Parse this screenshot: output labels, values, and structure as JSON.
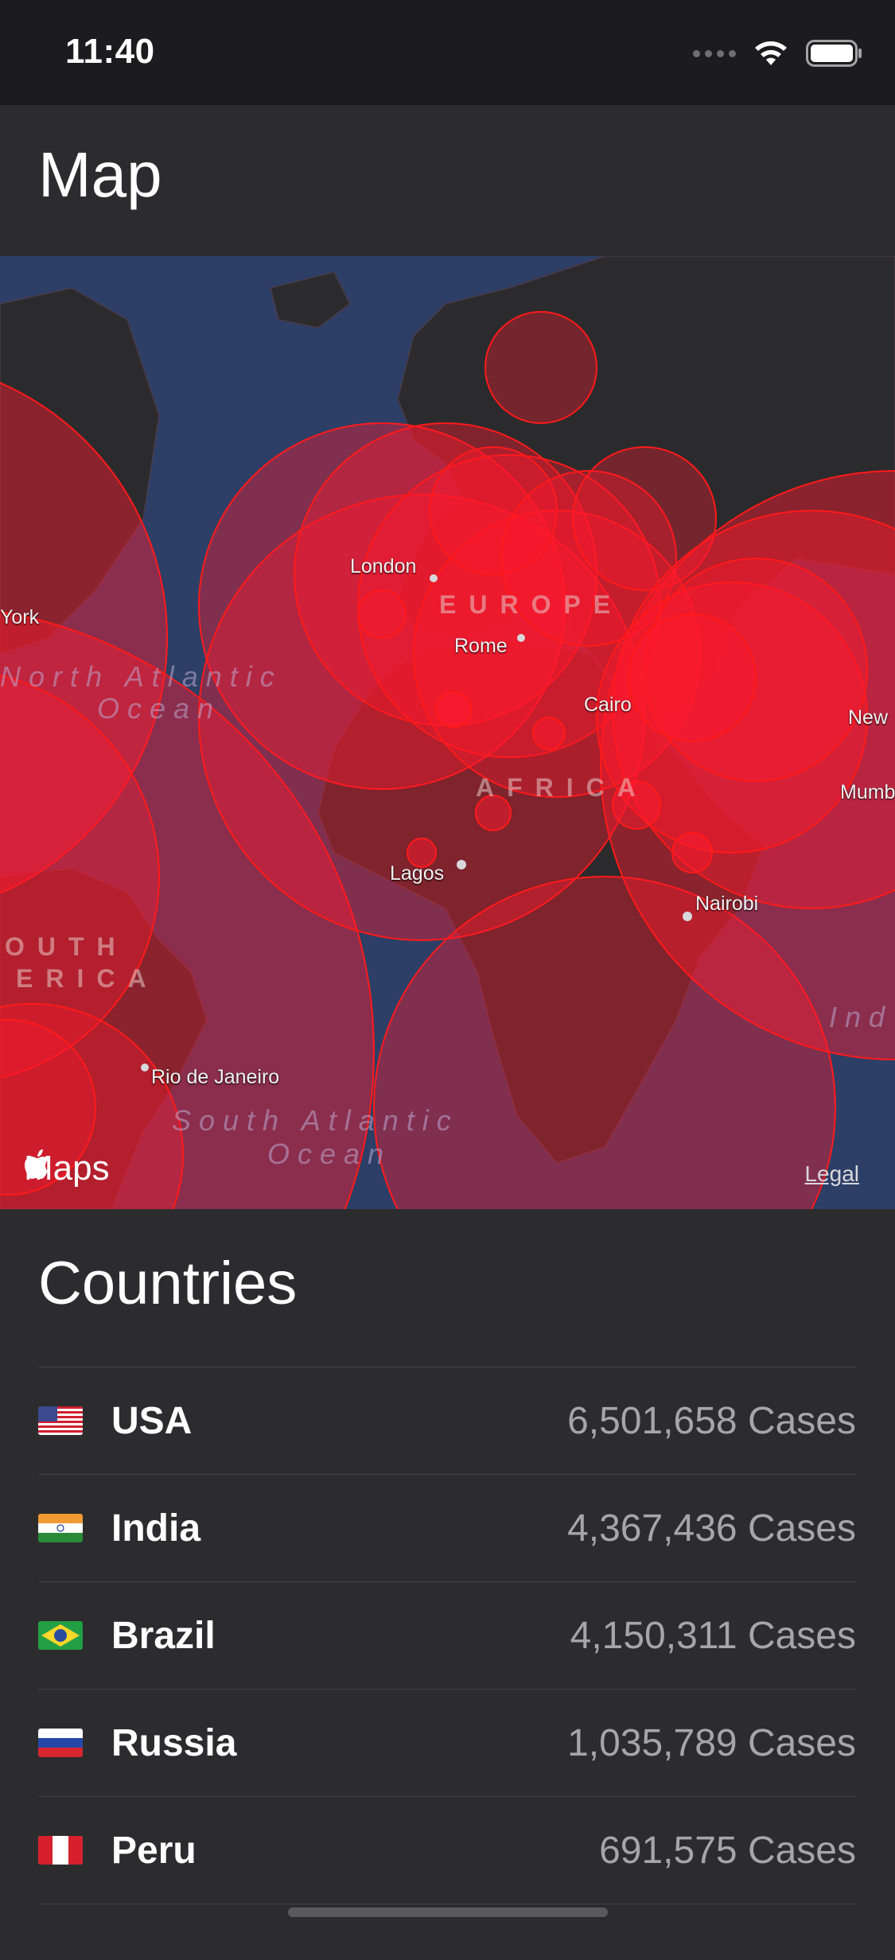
{
  "status_bar": {
    "time": "11:40",
    "icons": [
      "cellular-signal-icon",
      "wifi-icon",
      "battery-icon"
    ]
  },
  "nav": {
    "title": "Map"
  },
  "map": {
    "labels": {
      "london": "London",
      "europe": "EUROPE",
      "rome": "Rome",
      "cairo": "Cairo",
      "new_delhi": "New",
      "mumbai": "Mumb",
      "york": "York",
      "north_atlantic": "North Atlantic",
      "north_atlantic_2": "Ocean",
      "africa": "AFRICA",
      "lagos": "Lagos",
      "nairobi": "Nairobi",
      "south_america_1": "OUTH",
      "south_america_2": "ERICA",
      "rio": "Rio de Janeiro",
      "south_atlantic": "South Atlantic",
      "south_atlantic_2": "Ocean",
      "indian": "Ind"
    },
    "attribution": "Maps",
    "legal": "Legal",
    "colors": {
      "water": "#2d3f66",
      "land": "#2a2a2c",
      "case_circle": "#ff1a2e"
    }
  },
  "countries_section": {
    "title": "Countries",
    "rows": [
      {
        "name": "USA",
        "cases": "6,501,658 Cases",
        "flag": "us-flag-icon"
      },
      {
        "name": "India",
        "cases": "4,367,436 Cases",
        "flag": "india-flag-icon"
      },
      {
        "name": "Brazil",
        "cases": "4,150,311 Cases",
        "flag": "brazil-flag-icon"
      },
      {
        "name": "Russia",
        "cases": "1,035,789 Cases",
        "flag": "russia-flag-icon"
      },
      {
        "name": "Peru",
        "cases": "691,575 Cases",
        "flag": "peru-flag-icon"
      }
    ]
  }
}
